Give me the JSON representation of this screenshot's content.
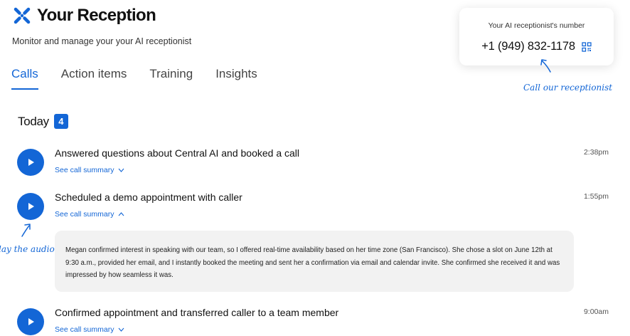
{
  "header": {
    "title": "Your Reception",
    "subtitle": "Monitor and manage your your AI receptionist",
    "brand_color": "#1366d6"
  },
  "tabs": [
    {
      "label": "Calls",
      "active": true
    },
    {
      "label": "Action items",
      "active": false
    },
    {
      "label": "Training",
      "active": false
    },
    {
      "label": "Insights",
      "active": false
    }
  ],
  "number_card": {
    "label": "Your AI receptionist's number",
    "phone": "+1 (949) 832-1178",
    "icon": "qr-code-icon"
  },
  "hints": {
    "call": "Call our receptionist",
    "play": "lay the audio"
  },
  "section": {
    "title": "Today",
    "count": "4"
  },
  "calls": [
    {
      "title": "Answered questions about Central AI and booked a call",
      "toggle": "See call summary",
      "time": "2:38pm",
      "expanded": false
    },
    {
      "title": "Scheduled a demo appointment with caller",
      "toggle": "See call summary",
      "time": "1:55pm",
      "expanded": true,
      "summary": "Megan confirmed interest in speaking with our team, so I offered real-time availability based on her time zone (San Francisco). She chose a slot on June 12th at 9:30 a.m., provided her email, and I instantly booked the meeting and sent her a confirmation via email and calendar invite. She confirmed she received it and was impressed by how seamless it was."
    },
    {
      "title": "Confirmed appointment and transferred caller to a team member",
      "toggle": "See call summary",
      "time": "9:00am",
      "expanded": false
    }
  ]
}
